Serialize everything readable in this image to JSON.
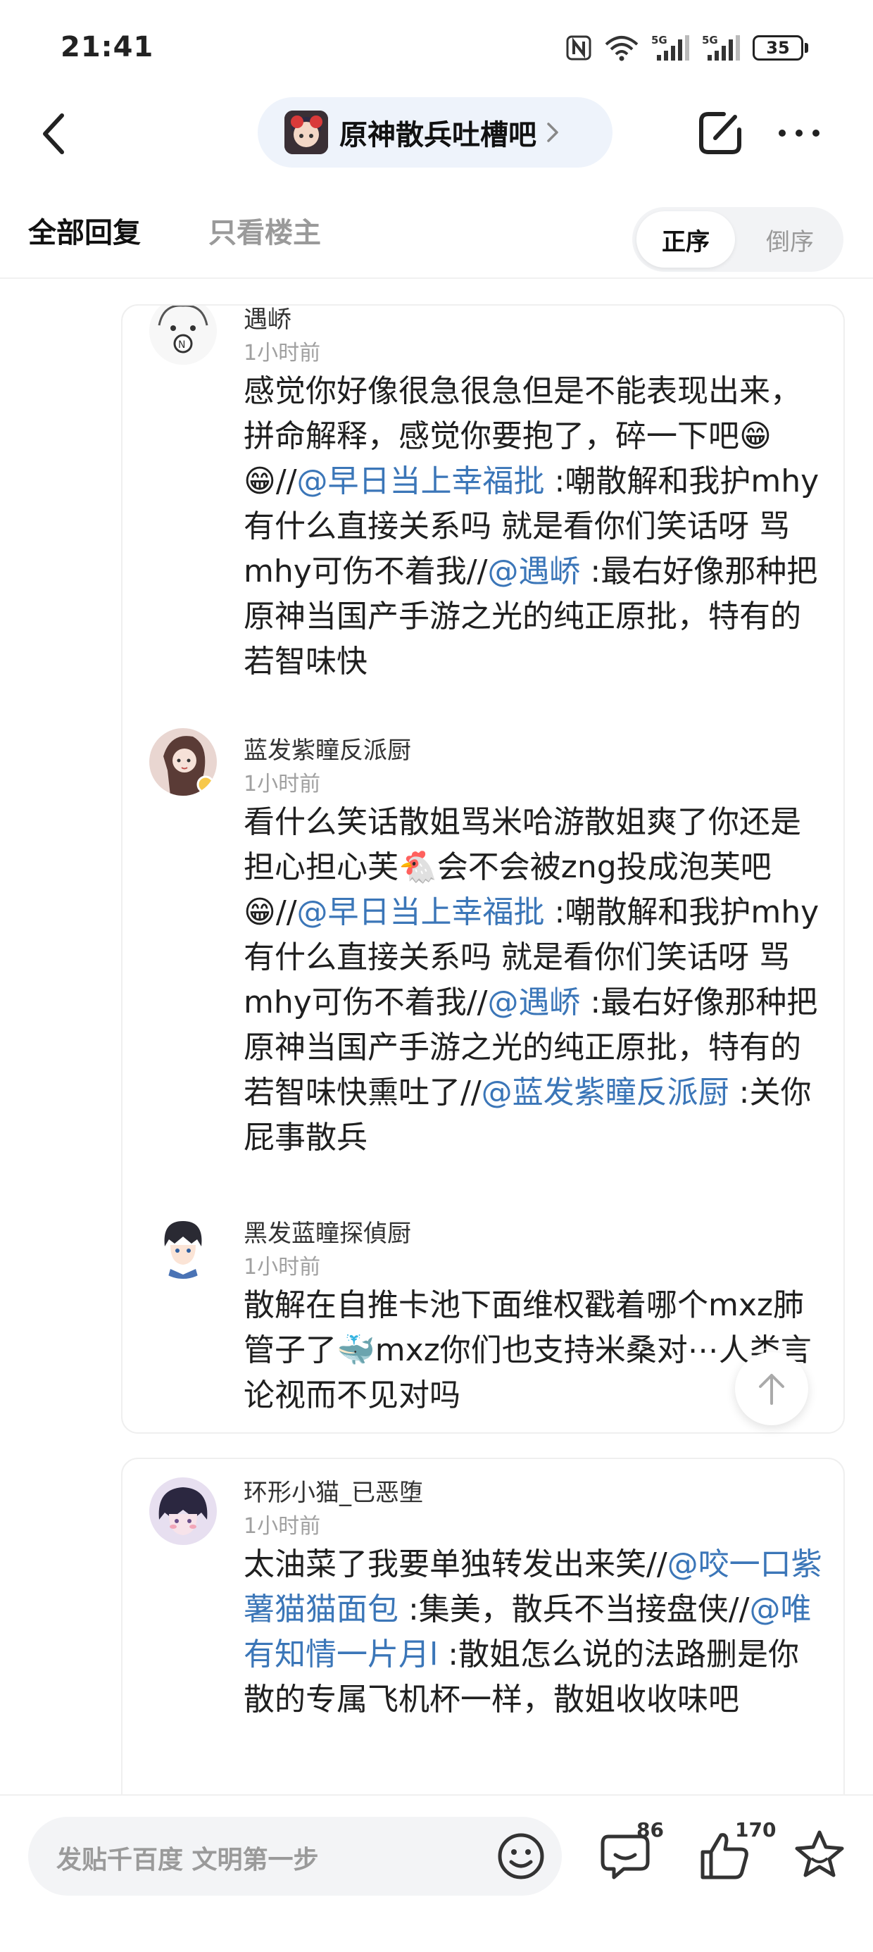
{
  "status_bar": {
    "time": "21:41",
    "battery": "35",
    "network": [
      "5G",
      "5G"
    ]
  },
  "nav": {
    "forum_name": "原神散兵吐槽吧",
    "icons": [
      "back-icon",
      "chevron-right-icon",
      "edit-icon",
      "more-icon"
    ]
  },
  "tabs": {
    "all": "全部回复",
    "op_only": "只看楼主",
    "sort_asc": "正序",
    "sort_desc": "倒序"
  },
  "replies": [
    {
      "name": "遇峤",
      "time": "1小时前",
      "t1": "感觉你好像很急很急但是不能表现出来，拼命解释，感觉你要抱了，碎一下吧",
      "emoji1": "😁😁",
      "t2": "//",
      "at1": "@早日当上幸福批",
      "t3": " :嘲散解和我护mhy有什么直接关系吗 就是看你们笑话呀 骂mhy可伤不着我//",
      "at2": "@遇峤",
      "t4": " :最右好像那种把原神当国产手游之光的纯正原批，特有的若智味快"
    },
    {
      "name": "蓝发紫瞳反派厨",
      "time": "1小时前",
      "t1": "看什么笑话散姐骂米哈游散姐爽了你还是担心担心芙",
      "emoji1": "🐔",
      "t2": "会不会被zng投成泡芙吧",
      "emoji2": "😁",
      "t3": "//",
      "at1": "@早日当上幸福批",
      "t4": " :嘲散解和我护mhy有什么直接关系吗 就是看你们笑话呀 骂mhy可伤不着我//",
      "at2": "@遇峤",
      "t5": " :最右好像那种把原神当国产手游之光的纯正原批，特有的若智味快熏吐了//",
      "at3": "@蓝发紫瞳反派厨",
      "t6": " :关你屁事散兵"
    },
    {
      "name": "黑发蓝瞳探偵厨",
      "time": "1小时前",
      "t1": "散解在自推卡池下面维权戳着哪个mxz肺管子了",
      "emoji1": "🐳",
      "t2": "mxz你们也支持米桑对⋯人类言论视而不见对吗"
    },
    {
      "name": "环形小猫_已恶堕",
      "time": "1小时前",
      "t1": "太油菜了我要单独转发出来笑//",
      "at1": "@咬一口紫薯猫猫面包",
      "t2": " :集美，散兵不当接盘侠//",
      "at2": "@唯有知情一片月l",
      "t3": " :散姐怎么说的法路删是你散的专属飞机杯一样，散姐收收味吧"
    }
  ],
  "bottom": {
    "placeholder": "发贴千百度 文明第一步",
    "comment_count": "86",
    "like_count": "170"
  }
}
